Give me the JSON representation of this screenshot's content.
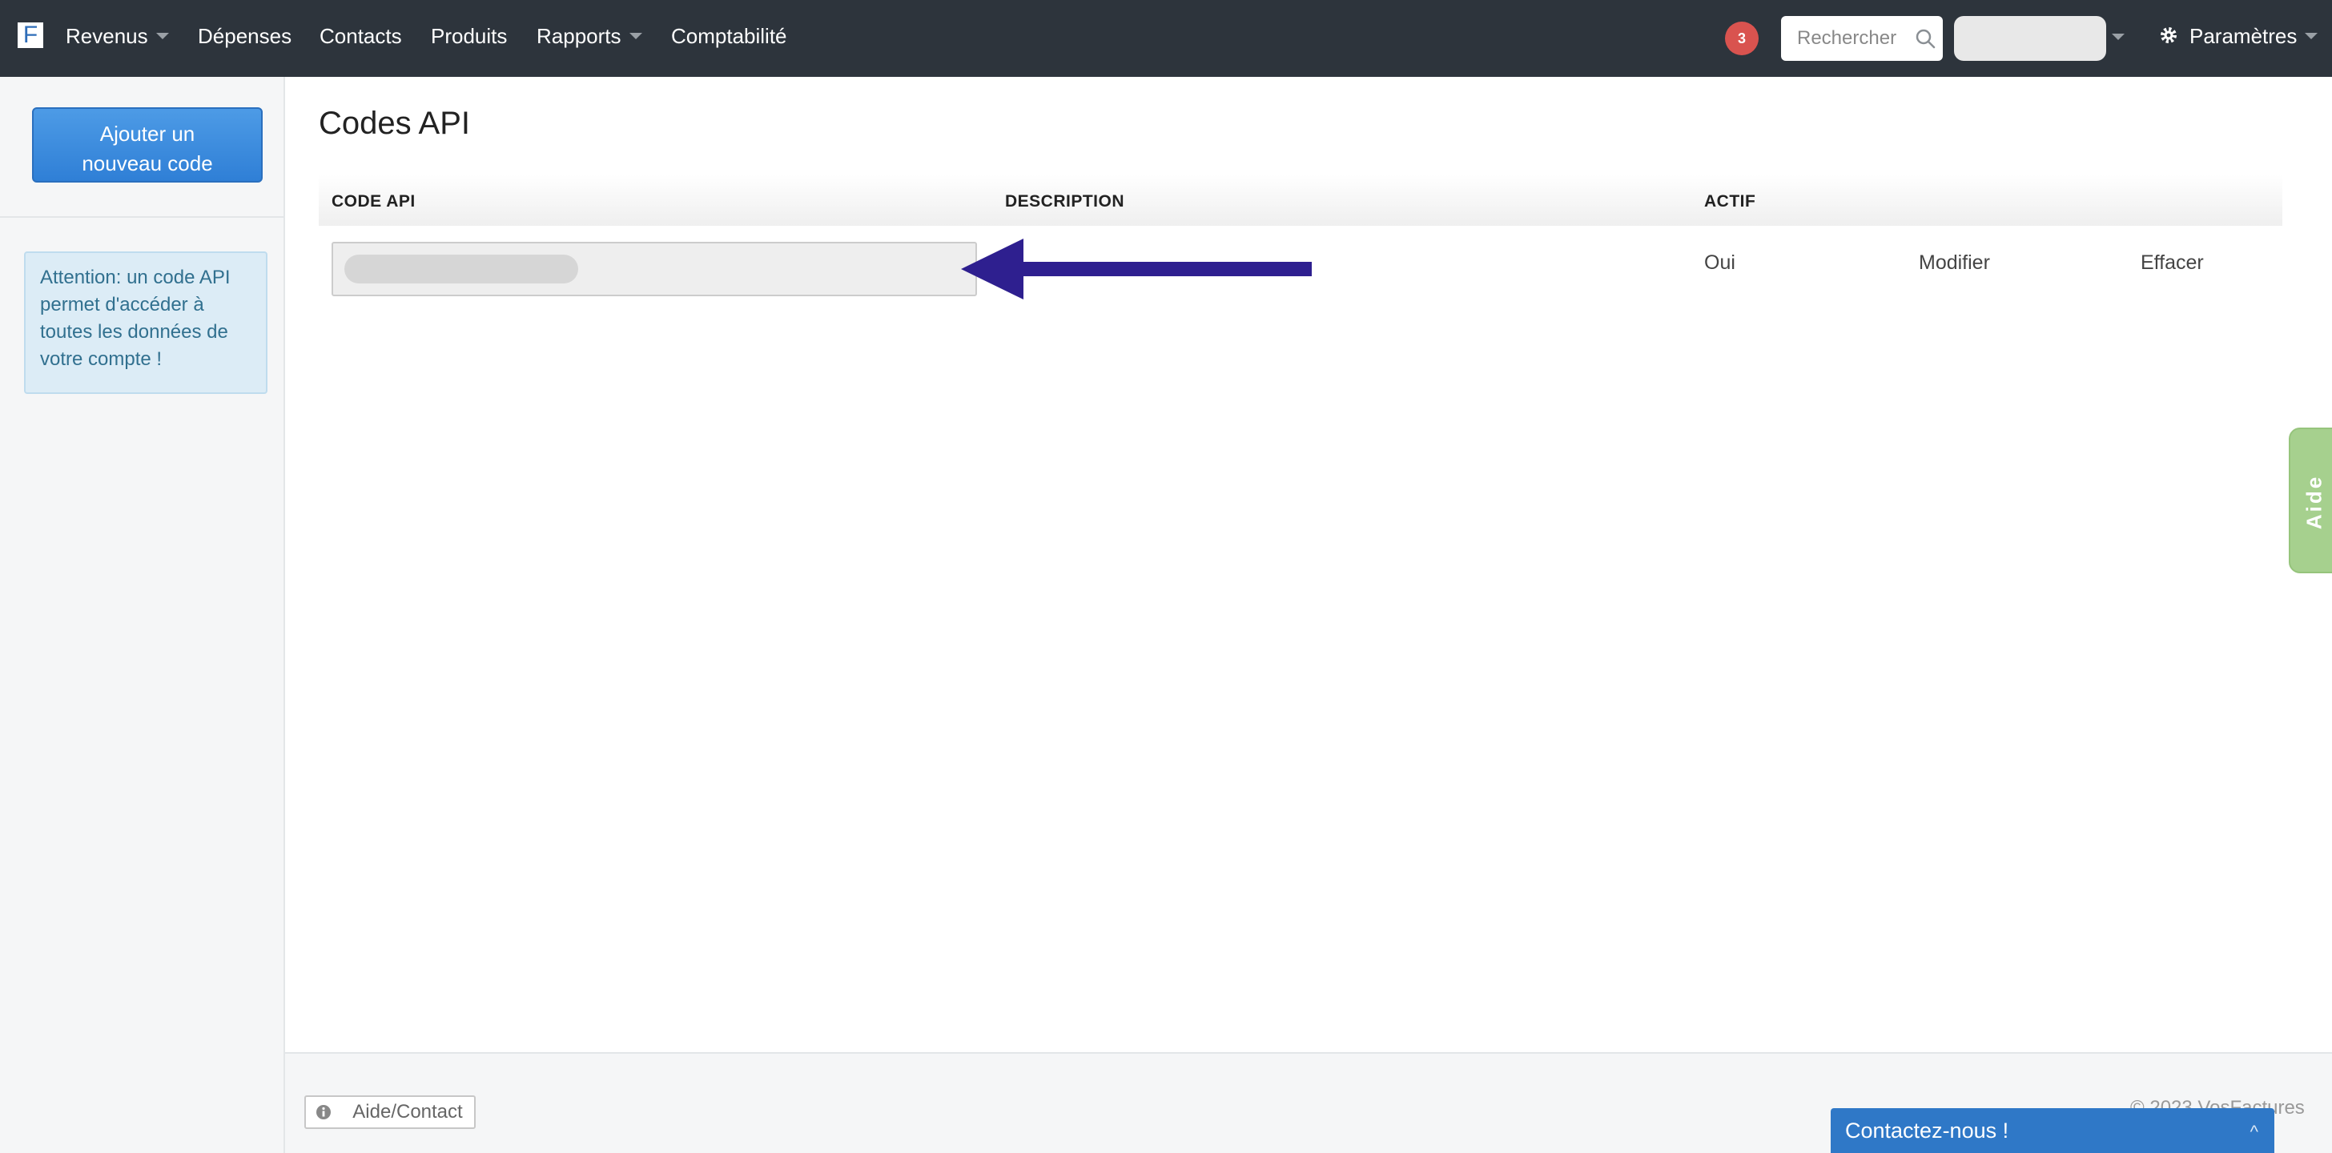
{
  "nav": {
    "brand_letter": "F",
    "items": [
      {
        "label": "Revenus",
        "dropdown": true
      },
      {
        "label": "Dépenses",
        "dropdown": false
      },
      {
        "label": "Contacts",
        "dropdown": false
      },
      {
        "label": "Produits",
        "dropdown": false
      },
      {
        "label": "Rapports",
        "dropdown": true
      },
      {
        "label": "Comptabilité",
        "dropdown": false
      }
    ],
    "notification_count": "3",
    "search_placeholder": "Rechercher",
    "settings_label": "Paramètres"
  },
  "sidebar": {
    "add_button_line1": "Ajouter un",
    "add_button_line2": "nouveau code",
    "alert_text": "Attention: un code API permet d'accéder à toutes les données de votre compte !"
  },
  "main": {
    "title": "Codes API",
    "columns": [
      "CODE API",
      "DESCRIPTION",
      "ACTIF"
    ],
    "rows": [
      {
        "code": "",
        "description": "",
        "active": "Oui",
        "edit": "Modifier",
        "delete": "Effacer"
      }
    ]
  },
  "aide_tab": "Aide",
  "footer": {
    "help_button": "Aide/Contact",
    "copyright": "© 2023 VosFactures",
    "contact_widget": "Contactez-nous !",
    "contact_chevron": "^"
  },
  "colors": {
    "navbar": "#2d343c",
    "primary_button": "#2f7fd6",
    "alert_bg": "#dcecf6",
    "alert_text": "#31708f",
    "badge": "#d9534f",
    "arrow": "#2e1f8f",
    "aide_tab": "#a6d08e",
    "contact_widget": "#2f78c7"
  },
  "icons": {
    "search": "search-icon",
    "settings": "gear-icon",
    "help": "info-icon",
    "annotation": "arrow-left-icon"
  }
}
